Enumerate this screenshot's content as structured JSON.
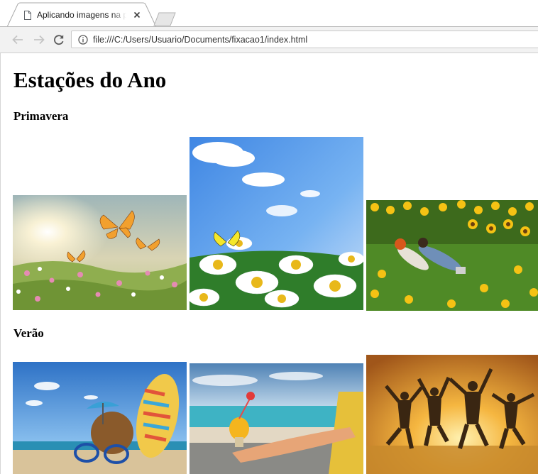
{
  "browser": {
    "tab_title": "Aplicando imagens na página",
    "url": "file:///C:/Users/Usuario/Documents/fixacao1/index.html"
  },
  "page": {
    "title": "Estações do Ano",
    "sections": [
      {
        "heading": "Primavera"
      },
      {
        "heading": "Verão"
      }
    ]
  }
}
